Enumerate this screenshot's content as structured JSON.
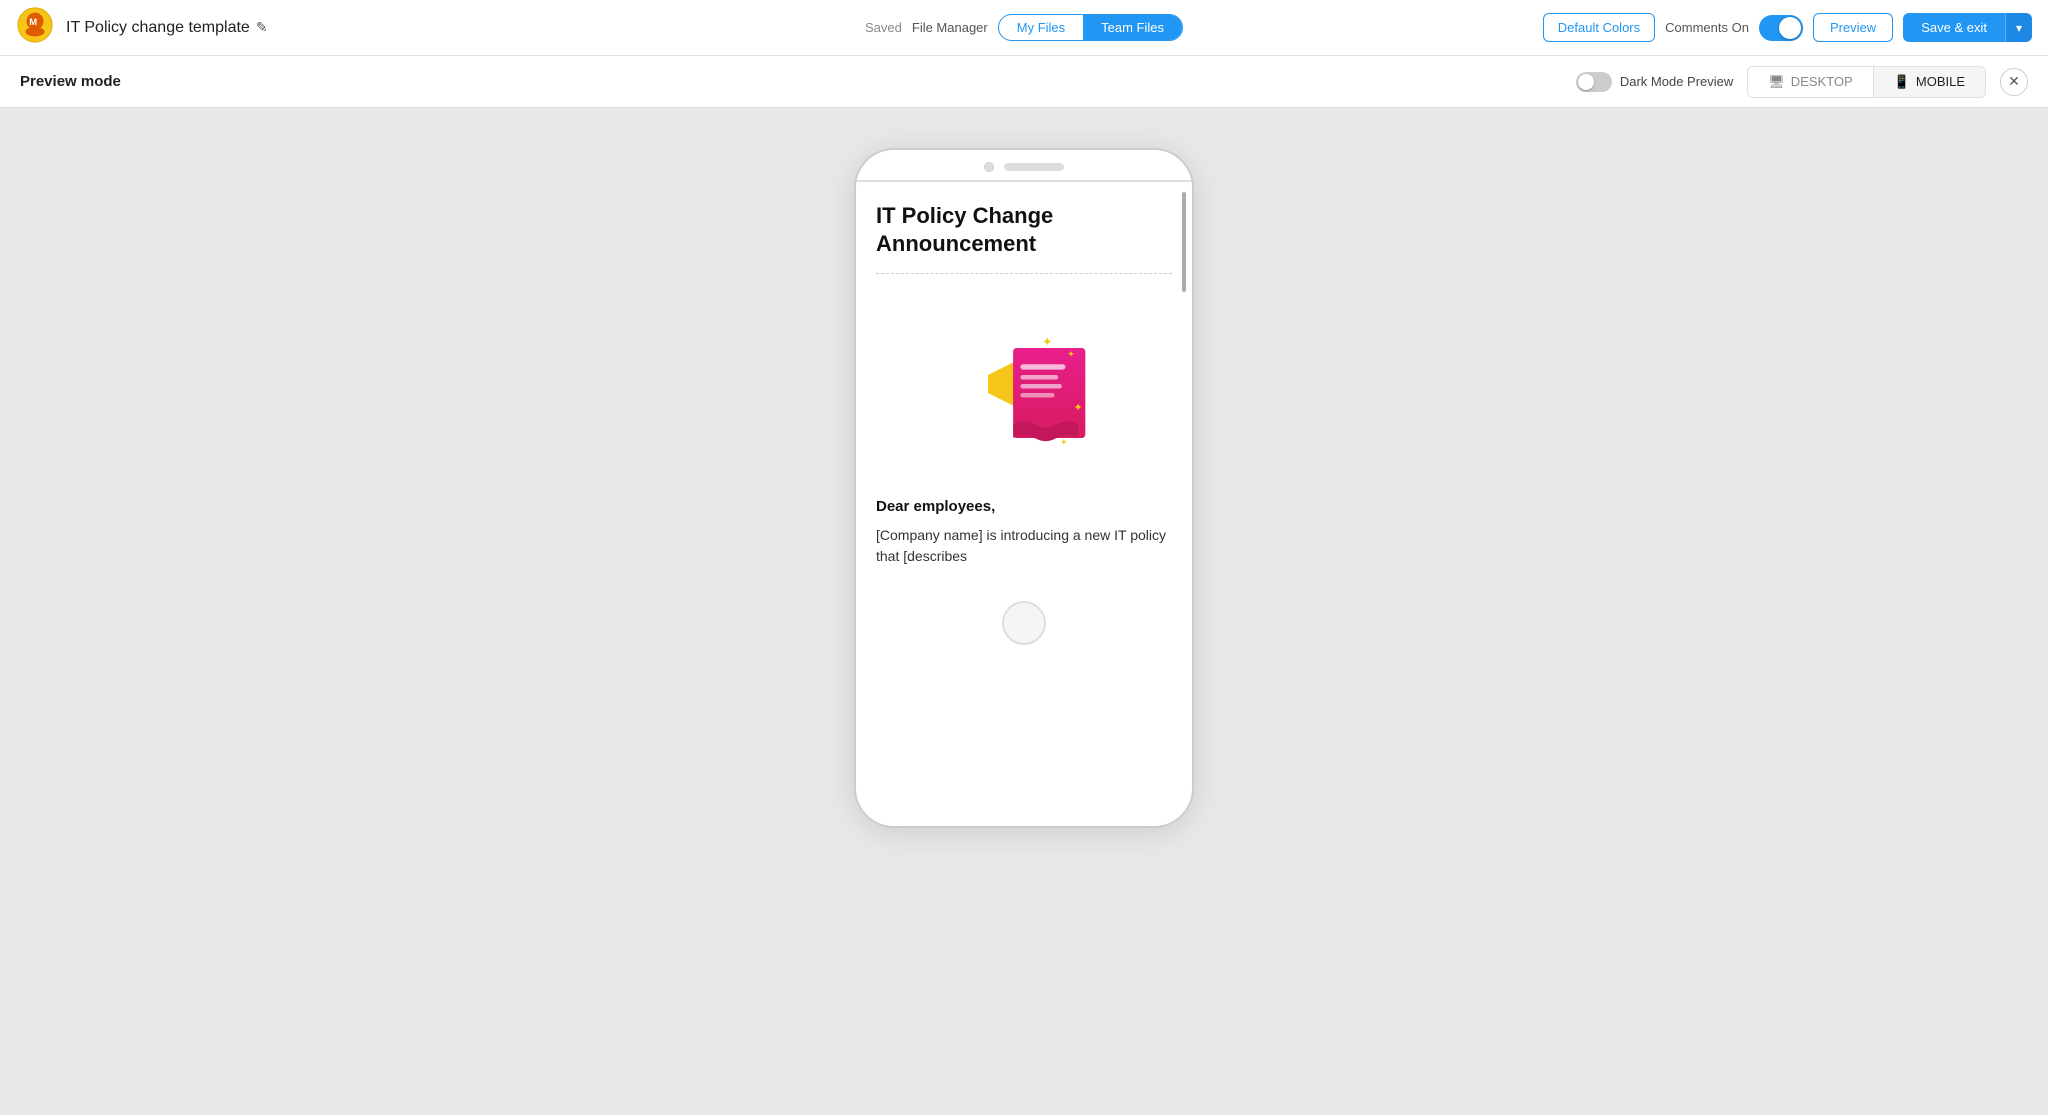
{
  "topbar": {
    "title": "IT Policy change template",
    "edit_icon": "✎",
    "saved_label": "Saved",
    "file_manager_label": "File Manager",
    "my_files_label": "My Files",
    "team_files_label": "Team Files",
    "default_colors_label": "Default Colors",
    "comments_on_label": "Comments On",
    "preview_label": "Preview",
    "save_exit_label": "Save & exit",
    "dropdown_arrow": "▾"
  },
  "preview_bar": {
    "label": "Preview mode",
    "dark_mode_label": "Dark Mode Preview",
    "desktop_label": "DESKTOP",
    "mobile_label": "MOBILE"
  },
  "phone_content": {
    "email_title": "IT Policy Change Announcement",
    "greeting": "Dear employees,",
    "body_text": "[Company name] is introducing a new IT policy that [describes"
  }
}
